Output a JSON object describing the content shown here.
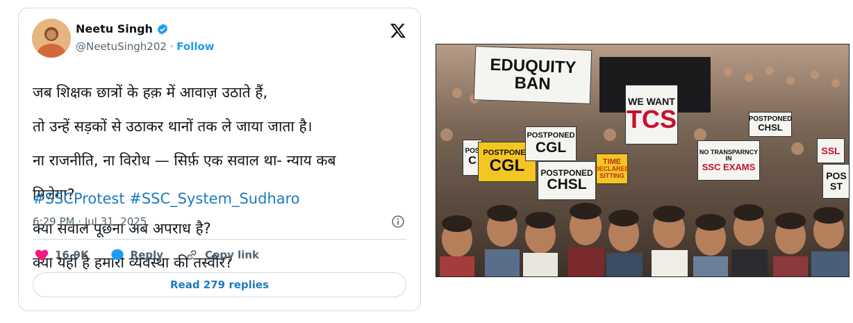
{
  "author": {
    "name": "Neetu Singh",
    "handle": "@NeetuSingh202",
    "separator": " · ",
    "follow_label": "Follow"
  },
  "tweet": {
    "lines": [
      "जब शिक्षक छात्रों के हक़ में आवाज़ उठाते हैं,",
      "तो उन्हें सड़कों से उठाकर थानों तक ले जाया जाता है।",
      "ना राजनीति, ना विरोध — सिर्फ़ एक सवाल था- न्याय कब",
      "मिलेगा?",
      "क्या सवाल पूछना अब अपराध है?",
      "क्या यही है हमारी व्यवस्था की तस्वीर?"
    ],
    "hashtags": [
      "#SSCProtest",
      "#SSC_System_Sudharo"
    ],
    "timestamp": "6:29 PM · Jul 31, 2025"
  },
  "actions": {
    "likes": "16.9K",
    "reply_label": "Reply",
    "copy_link_label": "Copy link",
    "read_replies_label": "Read 279 replies"
  },
  "photo": {
    "signs": {
      "eduquity": [
        "EDUQUITY",
        "BAN"
      ],
      "we_want": "WE WANT",
      "tcs": "TCS",
      "postponed_chsl_top": [
        "POSTPONED",
        "CHSL"
      ],
      "postponed_cgl_center": [
        "POSTPONED",
        "CGL"
      ],
      "postponed_cgl_yellow": [
        "POSTPONED",
        "CGL"
      ],
      "postponed_chsl_center": [
        "POSTPONED",
        "CHSL"
      ],
      "no_transparency": [
        "NO TRANSPARNCY",
        "IN",
        "SSC EXAMS"
      ],
      "yellow_small": [
        "TIME",
        "DECLARED",
        "SITTING"
      ],
      "edge_left": [
        "POS",
        "C"
      ],
      "edge_right": [
        "POS",
        "ST"
      ],
      "ssl_right": "SSL"
    }
  },
  "colors": {
    "accent": "#1d9bf0",
    "link": "#1d7bc0",
    "like": "#f91880",
    "muted": "#536471",
    "border": "#cfd9de"
  }
}
